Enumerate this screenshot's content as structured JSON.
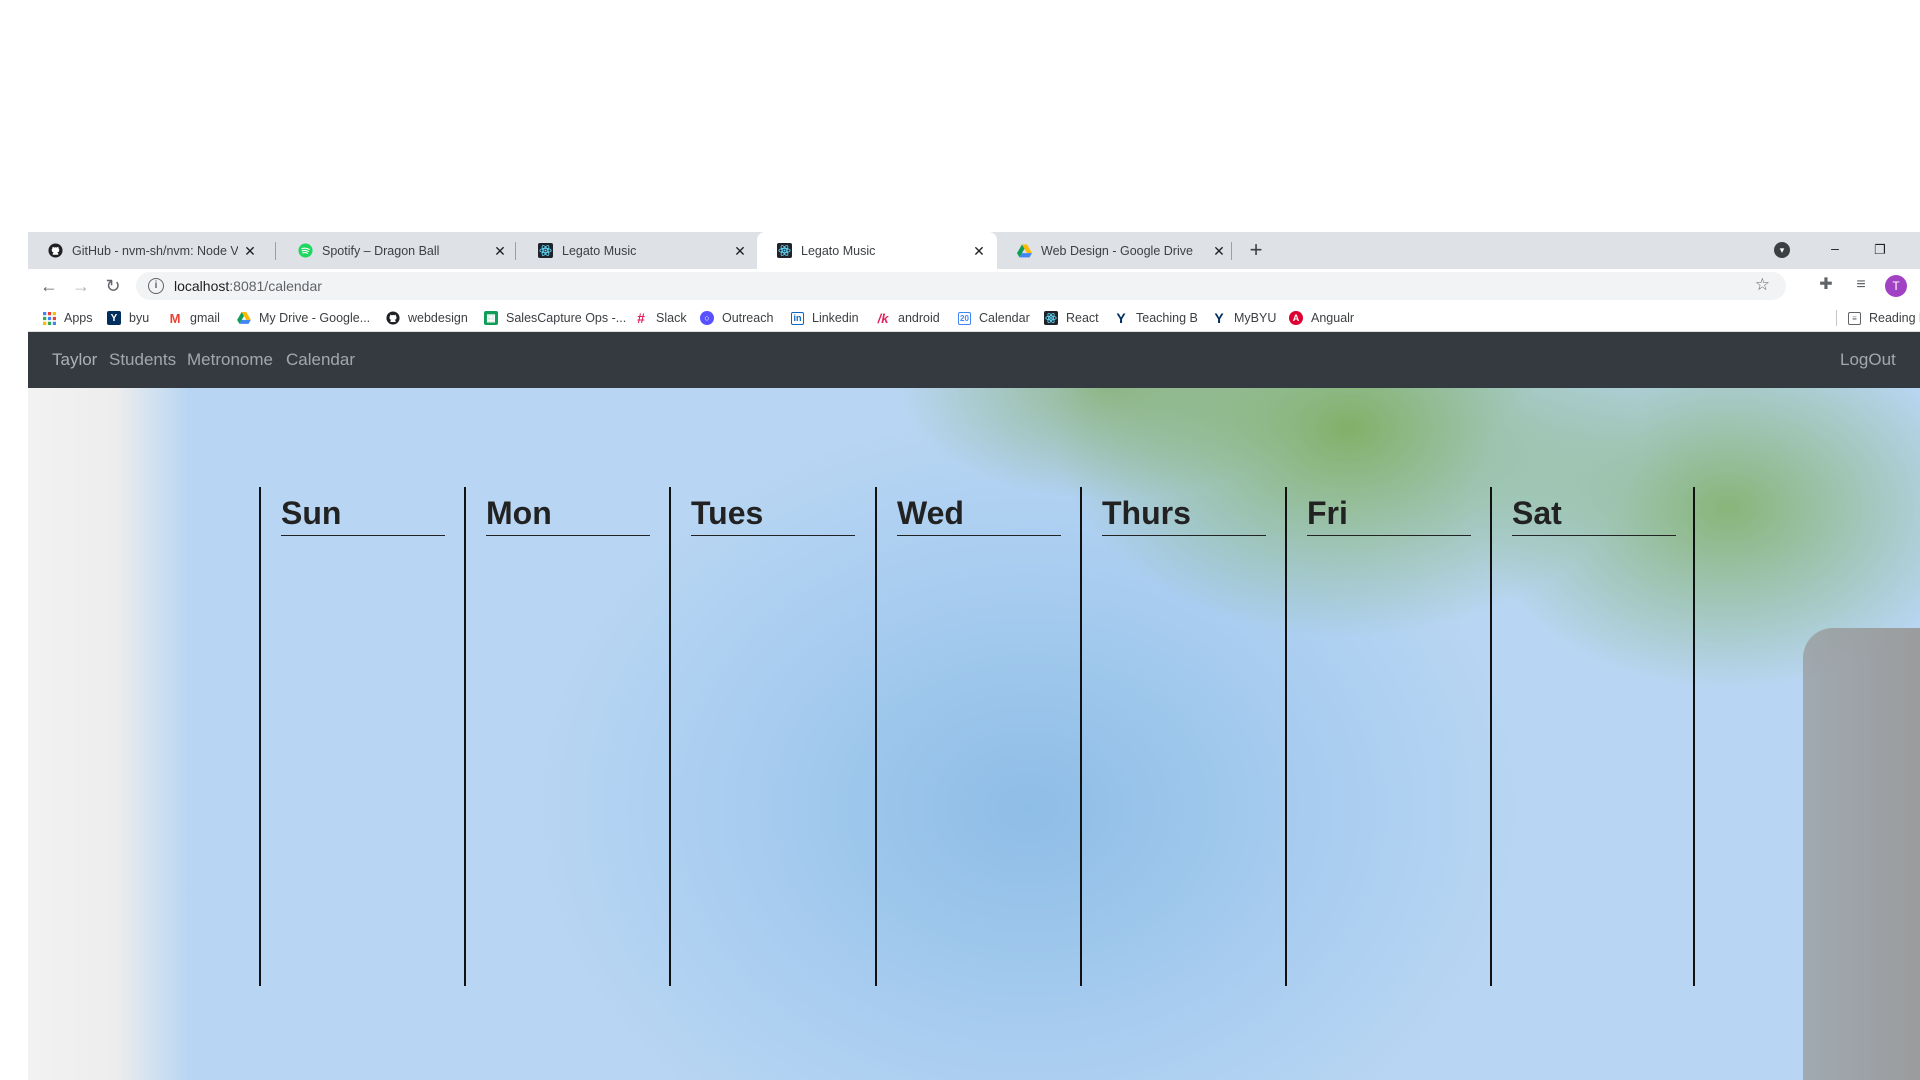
{
  "browser": {
    "tabs": [
      {
        "title": "GitHub - nvm-sh/nvm: Node Ver",
        "favicon": "github-icon",
        "active": false
      },
      {
        "title": "Spotify – Dragon Ball",
        "favicon": "spotify-icon",
        "active": false
      },
      {
        "title": "Legato Music",
        "favicon": "react-icon",
        "active": false
      },
      {
        "title": "Legato Music",
        "favicon": "react-icon",
        "active": true
      },
      {
        "title": "Web Design - Google Drive",
        "favicon": "google-drive-icon",
        "active": false
      }
    ],
    "address": {
      "host": "localhost",
      "path": ":8081/calendar"
    },
    "avatar_initial": "T",
    "bookmarks": [
      {
        "label": "Apps",
        "icon": "apps-grid-icon"
      },
      {
        "label": "byu",
        "icon": "byu-icon"
      },
      {
        "label": "gmail",
        "icon": "gmail-icon"
      },
      {
        "label": "My Drive - Google...",
        "icon": "google-drive-icon"
      },
      {
        "label": "webdesign",
        "icon": "github-icon"
      },
      {
        "label": "SalesCapture Ops -...",
        "icon": "sheets-icon"
      },
      {
        "label": "Slack",
        "icon": "slack-icon"
      },
      {
        "label": "Outreach",
        "icon": "outreach-icon"
      },
      {
        "label": "Linkedin",
        "icon": "linkedin-icon"
      },
      {
        "label": "android",
        "icon": "android-icon"
      },
      {
        "label": "Calendar",
        "icon": "calendar-icon"
      },
      {
        "label": "React",
        "icon": "react-icon"
      },
      {
        "label": "Teaching B",
        "icon": "byu-icon"
      },
      {
        "label": "MyBYU",
        "icon": "byu-icon"
      },
      {
        "label": "Angualr",
        "icon": "angular-icon"
      },
      {
        "label": "Reading l",
        "icon": "reading-list-icon"
      }
    ]
  },
  "navbar": {
    "brand": "Taylor",
    "links": [
      "Students",
      "Metronome",
      "Calendar"
    ],
    "logout": "LogOut"
  },
  "calendar": {
    "days": [
      "Sun",
      "Mon",
      "Tues",
      "Wed",
      "Thurs",
      "Fri",
      "Sat"
    ]
  },
  "colors": {
    "navbar_bg": "#343a40",
    "tabstrip_bg": "#dee1e6",
    "avatar_bg": "#a142c4"
  }
}
